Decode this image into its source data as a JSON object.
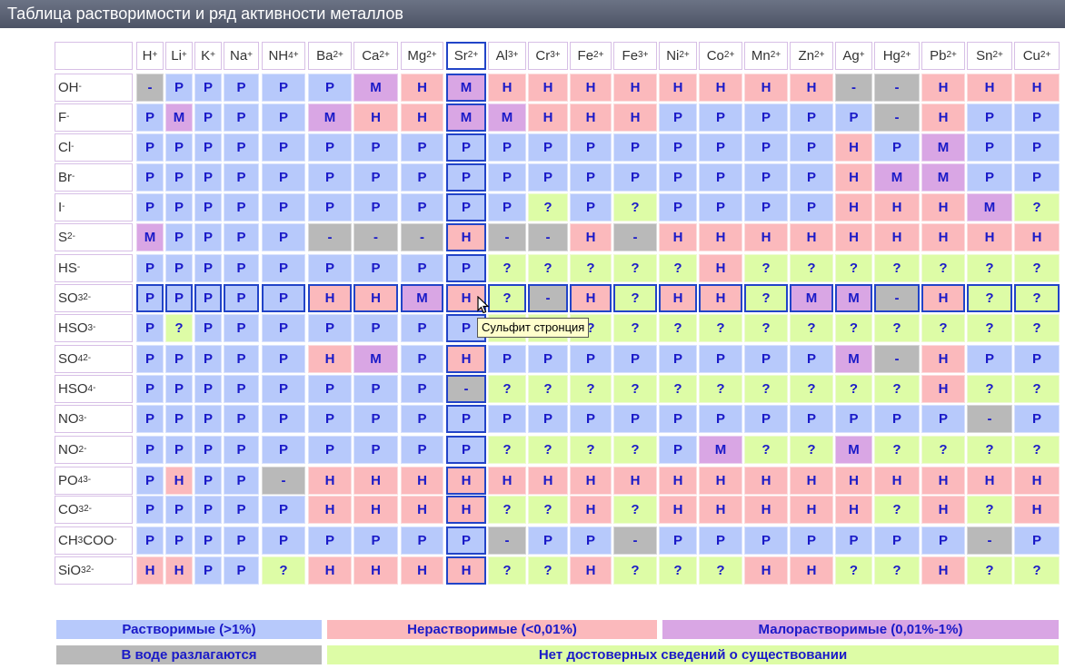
{
  "window": {
    "title": "Таблица растворимости и ряд активности металлов"
  },
  "cations": [
    {
      "base": "H",
      "sup": "+",
      "sub": ""
    },
    {
      "base": "Li",
      "sup": "+",
      "sub": ""
    },
    {
      "base": "K",
      "sup": "+",
      "sub": ""
    },
    {
      "base": "Na",
      "sup": "+",
      "sub": ""
    },
    {
      "base": "NH",
      "sub": "4",
      "sup": "+"
    },
    {
      "base": "Ba",
      "sup": "2+",
      "sub": ""
    },
    {
      "base": "Ca",
      "sup": "2+",
      "sub": ""
    },
    {
      "base": "Mg",
      "sup": "2+",
      "sub": ""
    },
    {
      "base": "Sr",
      "sup": "2+",
      "sub": ""
    },
    {
      "base": "Al",
      "sup": "3+",
      "sub": ""
    },
    {
      "base": "Cr",
      "sup": "3+",
      "sub": ""
    },
    {
      "base": "Fe",
      "sup": "2+",
      "sub": ""
    },
    {
      "base": "Fe",
      "sup": "3+",
      "sub": ""
    },
    {
      "base": "Ni",
      "sup": "2+",
      "sub": ""
    },
    {
      "base": "Co",
      "sup": "2+",
      "sub": ""
    },
    {
      "base": "Mn",
      "sup": "2+",
      "sub": ""
    },
    {
      "base": "Zn",
      "sup": "2+",
      "sub": ""
    },
    {
      "base": "Ag",
      "sup": "+",
      "sub": ""
    },
    {
      "base": "Hg",
      "sup": "2+",
      "sub": ""
    },
    {
      "base": "Pb",
      "sup": "2+",
      "sub": ""
    },
    {
      "base": "Sn",
      "sup": "2+",
      "sub": ""
    },
    {
      "base": "Cu",
      "sup": "2+",
      "sub": ""
    }
  ],
  "anions": [
    {
      "parts": [
        [
          "OH",
          ""
        ],
        [
          "",
          "-"
        ]
      ]
    },
    {
      "parts": [
        [
          "F",
          ""
        ],
        [
          "",
          "-"
        ]
      ]
    },
    {
      "parts": [
        [
          "Cl",
          ""
        ],
        [
          "",
          "-"
        ]
      ]
    },
    {
      "parts": [
        [
          "Br",
          ""
        ],
        [
          "",
          "-"
        ]
      ]
    },
    {
      "parts": [
        [
          "I",
          ""
        ],
        [
          "",
          "-"
        ]
      ]
    },
    {
      "parts": [
        [
          "S",
          ""
        ],
        [
          "",
          "2-"
        ]
      ]
    },
    {
      "parts": [
        [
          "HS",
          ""
        ],
        [
          "",
          "-"
        ]
      ]
    },
    {
      "parts": [
        [
          "SO",
          ""
        ],
        [
          "3",
          "sub"
        ],
        [
          "",
          "2-"
        ]
      ]
    },
    {
      "parts": [
        [
          "HSO",
          ""
        ],
        [
          "3",
          "sub"
        ],
        [
          "",
          "-"
        ]
      ]
    },
    {
      "parts": [
        [
          "SO",
          ""
        ],
        [
          "4",
          "sub"
        ],
        [
          "",
          "2-"
        ]
      ]
    },
    {
      "parts": [
        [
          "HSO",
          ""
        ],
        [
          "4",
          "sub"
        ],
        [
          "",
          "-"
        ]
      ]
    },
    {
      "parts": [
        [
          "NO",
          ""
        ],
        [
          "3",
          "sub"
        ],
        [
          "",
          "-"
        ]
      ]
    },
    {
      "parts": [
        [
          "NO",
          ""
        ],
        [
          "2",
          "sub"
        ],
        [
          "",
          "-"
        ]
      ]
    },
    {
      "parts": [
        [
          "PO",
          ""
        ],
        [
          "4",
          "sub"
        ],
        [
          "",
          "3-"
        ]
      ]
    },
    {
      "parts": [
        [
          "CO",
          ""
        ],
        [
          "3",
          "sub"
        ],
        [
          "",
          "2-"
        ]
      ]
    },
    {
      "parts": [
        [
          "CH",
          ""
        ],
        [
          "3",
          "sub"
        ],
        [
          "COO",
          ""
        ],
        [
          "",
          "-"
        ]
      ]
    },
    {
      "parts": [
        [
          "SiO",
          ""
        ],
        [
          "3",
          "sub"
        ],
        [
          "",
          "2-"
        ]
      ]
    }
  ],
  "cell_text": {
    "P": "Р",
    "N": "Н",
    "M": "М",
    "D": "-",
    "Q": "?"
  },
  "rows": [
    "D P P P P P M N M N N N N N N N N D D N N N",
    "P M P P P M N N M M N N N P P P P P D N P P",
    "P P P P P P P P P P P P P P P P P N P M P P",
    "P P P P P P P P P P P P P P P P P N M M P P",
    "P P P P P P P P P P Q P Q P P P P N N N M Q",
    "M P P P P D D D N D D N D N N N N N N N N N",
    "P P P P P P P P P Q Q Q Q Q N Q Q Q Q Q Q Q",
    "P P P P P N N M N Q D N Q N N Q M M D N Q Q",
    "P Q P P P P P P P Q Q Q Q Q Q Q Q Q Q Q Q Q",
    "P P P P P N M P N P P P P P P P P M D N P P",
    "P P P P P P P P D Q Q Q Q Q Q Q Q Q Q N Q Q",
    "P P P P P P P P P P P P P P P P P P P P D P",
    "P P P P P P P P P Q Q Q Q P M Q Q M Q Q Q Q",
    "P N P P D N N N N N N N N N N N N N N N N N",
    "P P P P P N N N N Q Q N Q N N N N N Q N Q N",
    "P P P P P P P P P D P P D P P P P P P P D P",
    "N N P P Q N N N N Q Q N Q Q Q N N Q Q N Q Q"
  ],
  "selection": {
    "column_index": 8,
    "row_index": 7
  },
  "tooltip": {
    "text": "Сульфит стронция"
  },
  "legend": [
    {
      "key": "P",
      "label": "Растворимые (>1%)"
    },
    {
      "key": "N",
      "label": "Нерастворимые (<0,01%)"
    },
    {
      "key": "M",
      "label": "Малорастворимые (0,01%-1%)"
    },
    {
      "key": "D",
      "label": "В воде разлагаются"
    },
    {
      "key": "Q",
      "label": "Нет достоверных сведений о существовании"
    }
  ],
  "colors": {
    "soluble": "#b7c9fb",
    "insoluble": "#fbb9bc",
    "slightly_soluble": "#d9a6e4",
    "decomposes": "#b9b9b9",
    "unknown": "#ddfca6",
    "selection_border": "#2244c8",
    "cell_text": "#1a1ac8"
  }
}
